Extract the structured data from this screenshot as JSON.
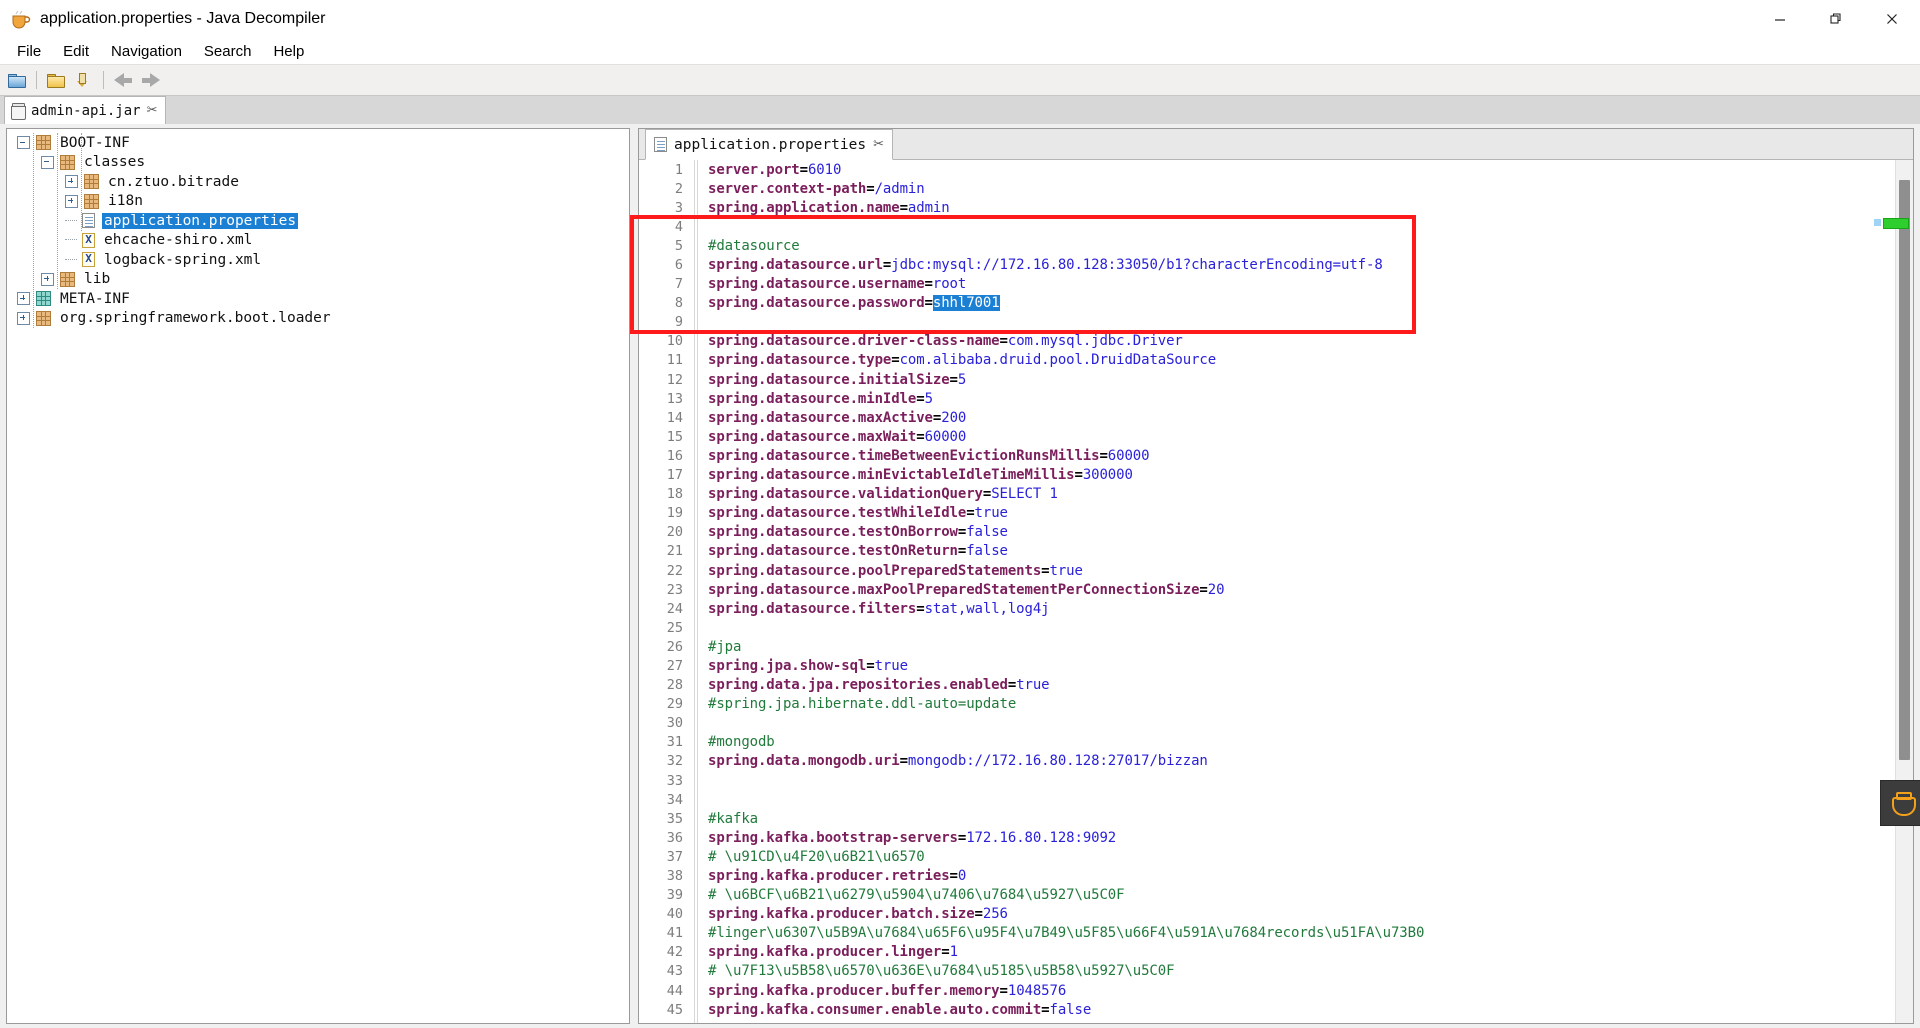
{
  "window": {
    "title": "application.properties - Java Decompiler",
    "app_icon": "coffee-cup-icon",
    "minimize_glyph": "—",
    "maximize_glyph": "❐",
    "close_glyph": "✕"
  },
  "menu": {
    "items": [
      {
        "label": "File"
      },
      {
        "label": "Edit"
      },
      {
        "label": "Navigation"
      },
      {
        "label": "Search"
      },
      {
        "label": "Help"
      }
    ]
  },
  "toolbar": {
    "buttons": [
      {
        "name": "open-file-icon",
        "tooltip": "Open File"
      },
      {
        "name": "open-type-icon",
        "tooltip": "Open Type"
      },
      {
        "name": "save-as-icon",
        "tooltip": "Save"
      },
      {
        "name": "back-icon",
        "tooltip": "Back"
      },
      {
        "name": "forward-icon",
        "tooltip": "Forward"
      }
    ]
  },
  "jar_tabs": [
    {
      "label": "admin-api.jar",
      "icon": "jar-icon",
      "close": "✂",
      "active": true
    }
  ],
  "tree": {
    "nodes": [
      {
        "label": "BOOT-INF",
        "depth": 0,
        "icon": "package-icon",
        "toggle": "minus",
        "selected": false
      },
      {
        "label": "classes",
        "depth": 1,
        "icon": "package-icon",
        "toggle": "minus",
        "selected": false
      },
      {
        "label": "cn.ztuo.bitrade",
        "depth": 2,
        "icon": "package-icon",
        "toggle": "plus",
        "selected": false
      },
      {
        "label": "i18n",
        "depth": 2,
        "icon": "package-icon",
        "toggle": "plus",
        "selected": false
      },
      {
        "label": "application.properties",
        "depth": 2,
        "icon": "properties-file-icon",
        "toggle": "leaf",
        "selected": true
      },
      {
        "label": "ehcache-shiro.xml",
        "depth": 2,
        "icon": "xml-file-icon",
        "toggle": "leaf",
        "selected": false
      },
      {
        "label": "logback-spring.xml",
        "depth": 2,
        "icon": "xml-file-icon",
        "toggle": "leaf",
        "selected": false
      },
      {
        "label": "lib",
        "depth": 1,
        "icon": "package-icon",
        "toggle": "plus",
        "selected": false
      },
      {
        "label": "META-INF",
        "depth": 0,
        "icon": "package-icon-teal",
        "toggle": "plus",
        "selected": false
      },
      {
        "label": "org.springframework.boot.loader",
        "depth": 0,
        "icon": "package-icon",
        "toggle": "plus",
        "selected": false
      }
    ]
  },
  "editor": {
    "tab": {
      "label": "application.properties",
      "icon": "properties-file-icon",
      "close": "✂"
    },
    "highlight": {
      "selected_value": "shhl7001",
      "line": 8
    },
    "annotation": {
      "color": "#fe1a1a",
      "covers_lines": "4-9"
    },
    "lines": [
      {
        "n": 1,
        "key": "server.port",
        "eq": "=",
        "val": "6010",
        "type": "kv"
      },
      {
        "n": 2,
        "key": "server.context-path",
        "eq": "=",
        "val": "/admin",
        "type": "kv"
      },
      {
        "n": 3,
        "key": "spring.application.name",
        "eq": "=",
        "val": "admin",
        "type": "kv"
      },
      {
        "n": 4,
        "text": "",
        "type": "blank"
      },
      {
        "n": 5,
        "text": "#datasource",
        "type": "comment"
      },
      {
        "n": 6,
        "key": "spring.datasource.url",
        "eq": "=",
        "val": "jdbc:mysql://172.16.80.128:33050/b1?characterEncoding=utf-8",
        "type": "kv"
      },
      {
        "n": 7,
        "key": "spring.datasource.username",
        "eq": "=",
        "val": "root",
        "type": "kv"
      },
      {
        "n": 8,
        "key": "spring.datasource.password",
        "eq": "=",
        "val": "shhl7001",
        "type": "kv-selected"
      },
      {
        "n": 9,
        "text": "",
        "type": "blank"
      },
      {
        "n": 10,
        "key": "spring.datasource.driver-class-name",
        "eq": "=",
        "val": "com.mysql.jdbc.Driver",
        "type": "kv"
      },
      {
        "n": 11,
        "key": "spring.datasource.type",
        "eq": "=",
        "val": "com.alibaba.druid.pool.DruidDataSource",
        "type": "kv"
      },
      {
        "n": 12,
        "key": "spring.datasource.initialSize",
        "eq": "=",
        "val": "5",
        "type": "kv"
      },
      {
        "n": 13,
        "key": "spring.datasource.minIdle",
        "eq": "=",
        "val": "5",
        "type": "kv"
      },
      {
        "n": 14,
        "key": "spring.datasource.maxActive",
        "eq": "=",
        "val": "200",
        "type": "kv"
      },
      {
        "n": 15,
        "key": "spring.datasource.maxWait",
        "eq": "=",
        "val": "60000",
        "type": "kv"
      },
      {
        "n": 16,
        "key": "spring.datasource.timeBetweenEvictionRunsMillis",
        "eq": "=",
        "val": "60000",
        "type": "kv"
      },
      {
        "n": 17,
        "key": "spring.datasource.minEvictableIdleTimeMillis",
        "eq": "=",
        "val": "300000",
        "type": "kv"
      },
      {
        "n": 18,
        "key": "spring.datasource.validationQuery",
        "eq": "=",
        "val": "SELECT 1",
        "type": "kv"
      },
      {
        "n": 19,
        "key": "spring.datasource.testWhileIdle",
        "eq": "=",
        "val": "true",
        "type": "kv"
      },
      {
        "n": 20,
        "key": "spring.datasource.testOnBorrow",
        "eq": "=",
        "val": "false",
        "type": "kv"
      },
      {
        "n": 21,
        "key": "spring.datasource.testOnReturn",
        "eq": "=",
        "val": "false",
        "type": "kv"
      },
      {
        "n": 22,
        "key": "spring.datasource.poolPreparedStatements",
        "eq": "=",
        "val": "true",
        "type": "kv"
      },
      {
        "n": 23,
        "key": "spring.datasource.maxPoolPreparedStatementPerConnectionSize",
        "eq": "=",
        "val": "20",
        "type": "kv"
      },
      {
        "n": 24,
        "key": "spring.datasource.filters",
        "eq": "=",
        "val": "stat,wall,log4j",
        "type": "kv"
      },
      {
        "n": 25,
        "text": "",
        "type": "blank"
      },
      {
        "n": 26,
        "text": "#jpa",
        "type": "comment"
      },
      {
        "n": 27,
        "key": "spring.jpa.show-sql",
        "eq": "=",
        "val": "true",
        "type": "kv"
      },
      {
        "n": 28,
        "key": "spring.data.jpa.repositories.enabled",
        "eq": "=",
        "val": "true",
        "type": "kv"
      },
      {
        "n": 29,
        "text": "#spring.jpa.hibernate.ddl-auto=update",
        "type": "comment"
      },
      {
        "n": 30,
        "text": "",
        "type": "blank"
      },
      {
        "n": 31,
        "text": "#mongodb",
        "type": "comment"
      },
      {
        "n": 32,
        "key": "spring.data.mongodb.uri",
        "eq": "=",
        "val": "mongodb://172.16.80.128:27017/bizzan",
        "type": "kv"
      },
      {
        "n": 33,
        "text": "",
        "type": "blank"
      },
      {
        "n": 34,
        "text": "",
        "type": "blank"
      },
      {
        "n": 35,
        "text": "#kafka",
        "type": "comment"
      },
      {
        "n": 36,
        "key": "spring.kafka.bootstrap-servers",
        "eq": "=",
        "val": "172.16.80.128:9092",
        "type": "kv"
      },
      {
        "n": 37,
        "text": "# \\u91CD\\u4F20\\u6B21\\u6570",
        "type": "comment"
      },
      {
        "n": 38,
        "key": "spring.kafka.producer.retries",
        "eq": "=",
        "val": "0",
        "type": "kv"
      },
      {
        "n": 39,
        "text": "# \\u6BCF\\u6B21\\u6279\\u5904\\u7406\\u7684\\u5927\\u5C0F",
        "type": "comment"
      },
      {
        "n": 40,
        "key": "spring.kafka.producer.batch.size",
        "eq": "=",
        "val": "256",
        "type": "kv"
      },
      {
        "n": 41,
        "text": "#linger\\u6307\\u5B9A\\u7684\\u65F6\\u95F4\\u7B49\\u5F85\\u66F4\\u591A\\u7684records\\u51FA\\u73B0",
        "type": "comment"
      },
      {
        "n": 42,
        "key": "spring.kafka.producer.linger",
        "eq": "=",
        "val": "1",
        "type": "kv"
      },
      {
        "n": 43,
        "text": "# \\u7F13\\u5B58\\u6570\\u636E\\u7684\\u5185\\u5B58\\u5927\\u5C0F",
        "type": "comment"
      },
      {
        "n": 44,
        "key": "spring.kafka.producer.buffer.memory",
        "eq": "=",
        "val": "1048576",
        "type": "kv"
      },
      {
        "n": 45,
        "key": "spring.kafka.consumer.enable.auto.commit",
        "eq": "=",
        "val": "false",
        "type": "kv"
      }
    ]
  },
  "overlays": {
    "corner_widget_icon": "pot-icon",
    "green_marker": "occurrence-marker",
    "blue_marker": "occurrence-marker-small"
  },
  "colors": {
    "selection": "#1b7fd4",
    "annotation": "#fe1a1a",
    "key": "#7b1f5c",
    "value": "#2a21d8",
    "comment": "#217a3c"
  }
}
